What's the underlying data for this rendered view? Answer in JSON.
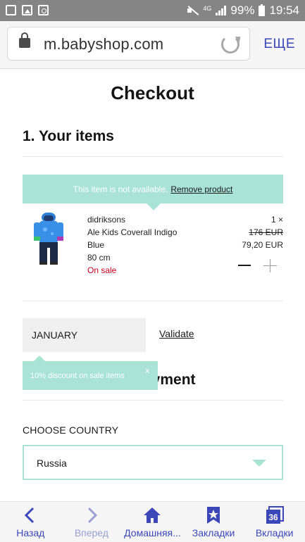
{
  "status_bar": {
    "network": "4G",
    "battery": "99%",
    "time": "19:54"
  },
  "browser": {
    "url": "m.babyshop.com",
    "more_label": "ЕЩЕ"
  },
  "page": {
    "title": "Checkout",
    "section1_title": "1. Your items",
    "notice": {
      "text": "This item is not available.",
      "link": "Remove product"
    },
    "product": {
      "brand": "didriksons",
      "name": "Ale Kids Coverall Indigo",
      "color": "Blue",
      "size": "80 cm",
      "sale_label": "On sale",
      "quantity": "1 ×",
      "old_price": "176 EUR",
      "price": "79,20 EUR"
    },
    "discount": {
      "code_value": "JANUARY",
      "validate_label": "Validate"
    },
    "tooltip": {
      "text": "10% discount on sale items",
      "close": "x"
    },
    "section2_title_visible": "ayment",
    "country": {
      "label": "CHOOSE COUNTRY",
      "value": "Russia"
    }
  },
  "bottom_nav": [
    {
      "label": "Назад",
      "icon": "back-arrow-icon"
    },
    {
      "label": "Вперед",
      "icon": "forward-arrow-icon"
    },
    {
      "label": "Домашняя...",
      "icon": "home-icon"
    },
    {
      "label": "Закладки",
      "icon": "bookmark-star-icon"
    },
    {
      "label": "Вкладки",
      "icon": "tabs-icon",
      "count": "36"
    }
  ],
  "colors": {
    "accent": "#a8e3d6",
    "sale": "#d0021b",
    "nav": "#3b46b8"
  }
}
